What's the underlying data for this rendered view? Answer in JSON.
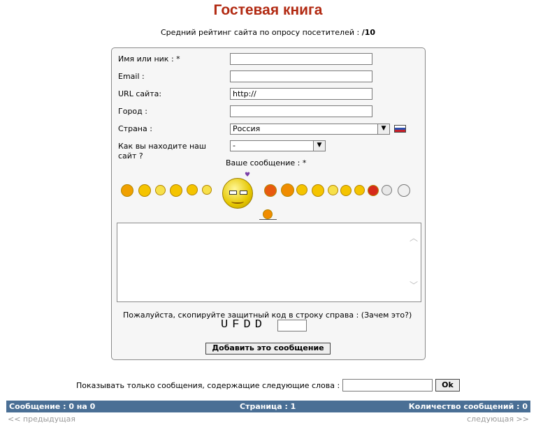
{
  "header": {
    "title": "Гостевая книга",
    "rating_label": "Средний рейтинг сайта по опросу посетителей :",
    "rating_value": "/10"
  },
  "form": {
    "name_label": "Имя или ник : *",
    "name_value": "",
    "email_label": "Email :",
    "email_value": "",
    "url_label": "URL сайта:",
    "url_value": "http://",
    "city_label": "Город :",
    "city_value": "",
    "country_label": "Страна :",
    "country_value": "Россия",
    "find_label_line1": "Как вы находите наш",
    "find_label_line2": "сайт ?",
    "find_value": "-",
    "message_label": "Ваше сообщение : *",
    "message_value": "",
    "captcha_prompt": "Пожалуйста, скопируйте защитный код в строку справа : (Зачем это?)",
    "captcha_code": "UFDD",
    "captcha_value": "",
    "submit_label": "Добавить это сообщение"
  },
  "filter": {
    "label": "Показывать только сообщения, содержащие следующие слова :",
    "value": "",
    "ok_label": "Ok"
  },
  "status": {
    "messages": "Сообщение : 0 на 0",
    "page": "Страница : 1",
    "count": "Количество сообщений : 0"
  },
  "nav": {
    "prev": "<< предыдущая",
    "next": "следующая >>"
  },
  "colors": {
    "title": "#b22a12",
    "status_bar": "#4a6f95"
  }
}
